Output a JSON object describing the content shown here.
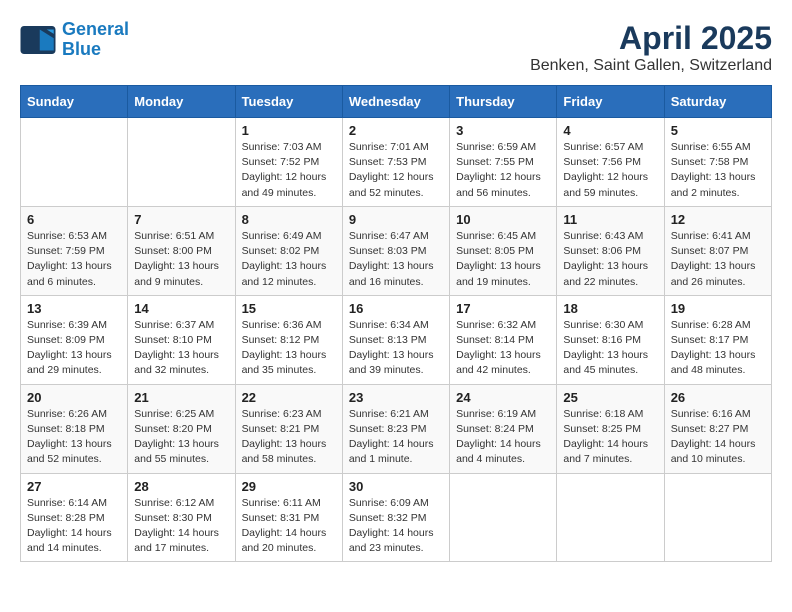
{
  "logo": {
    "line1": "General",
    "line2": "Blue"
  },
  "title": "April 2025",
  "subtitle": "Benken, Saint Gallen, Switzerland",
  "headers": [
    "Sunday",
    "Monday",
    "Tuesday",
    "Wednesday",
    "Thursday",
    "Friday",
    "Saturday"
  ],
  "weeks": [
    [
      {
        "day": "",
        "info": ""
      },
      {
        "day": "",
        "info": ""
      },
      {
        "day": "1",
        "info": "Sunrise: 7:03 AM\nSunset: 7:52 PM\nDaylight: 12 hours and 49 minutes."
      },
      {
        "day": "2",
        "info": "Sunrise: 7:01 AM\nSunset: 7:53 PM\nDaylight: 12 hours and 52 minutes."
      },
      {
        "day": "3",
        "info": "Sunrise: 6:59 AM\nSunset: 7:55 PM\nDaylight: 12 hours and 56 minutes."
      },
      {
        "day": "4",
        "info": "Sunrise: 6:57 AM\nSunset: 7:56 PM\nDaylight: 12 hours and 59 minutes."
      },
      {
        "day": "5",
        "info": "Sunrise: 6:55 AM\nSunset: 7:58 PM\nDaylight: 13 hours and 2 minutes."
      }
    ],
    [
      {
        "day": "6",
        "info": "Sunrise: 6:53 AM\nSunset: 7:59 PM\nDaylight: 13 hours and 6 minutes."
      },
      {
        "day": "7",
        "info": "Sunrise: 6:51 AM\nSunset: 8:00 PM\nDaylight: 13 hours and 9 minutes."
      },
      {
        "day": "8",
        "info": "Sunrise: 6:49 AM\nSunset: 8:02 PM\nDaylight: 13 hours and 12 minutes."
      },
      {
        "day": "9",
        "info": "Sunrise: 6:47 AM\nSunset: 8:03 PM\nDaylight: 13 hours and 16 minutes."
      },
      {
        "day": "10",
        "info": "Sunrise: 6:45 AM\nSunset: 8:05 PM\nDaylight: 13 hours and 19 minutes."
      },
      {
        "day": "11",
        "info": "Sunrise: 6:43 AM\nSunset: 8:06 PM\nDaylight: 13 hours and 22 minutes."
      },
      {
        "day": "12",
        "info": "Sunrise: 6:41 AM\nSunset: 8:07 PM\nDaylight: 13 hours and 26 minutes."
      }
    ],
    [
      {
        "day": "13",
        "info": "Sunrise: 6:39 AM\nSunset: 8:09 PM\nDaylight: 13 hours and 29 minutes."
      },
      {
        "day": "14",
        "info": "Sunrise: 6:37 AM\nSunset: 8:10 PM\nDaylight: 13 hours and 32 minutes."
      },
      {
        "day": "15",
        "info": "Sunrise: 6:36 AM\nSunset: 8:12 PM\nDaylight: 13 hours and 35 minutes."
      },
      {
        "day": "16",
        "info": "Sunrise: 6:34 AM\nSunset: 8:13 PM\nDaylight: 13 hours and 39 minutes."
      },
      {
        "day": "17",
        "info": "Sunrise: 6:32 AM\nSunset: 8:14 PM\nDaylight: 13 hours and 42 minutes."
      },
      {
        "day": "18",
        "info": "Sunrise: 6:30 AM\nSunset: 8:16 PM\nDaylight: 13 hours and 45 minutes."
      },
      {
        "day": "19",
        "info": "Sunrise: 6:28 AM\nSunset: 8:17 PM\nDaylight: 13 hours and 48 minutes."
      }
    ],
    [
      {
        "day": "20",
        "info": "Sunrise: 6:26 AM\nSunset: 8:18 PM\nDaylight: 13 hours and 52 minutes."
      },
      {
        "day": "21",
        "info": "Sunrise: 6:25 AM\nSunset: 8:20 PM\nDaylight: 13 hours and 55 minutes."
      },
      {
        "day": "22",
        "info": "Sunrise: 6:23 AM\nSunset: 8:21 PM\nDaylight: 13 hours and 58 minutes."
      },
      {
        "day": "23",
        "info": "Sunrise: 6:21 AM\nSunset: 8:23 PM\nDaylight: 14 hours and 1 minute."
      },
      {
        "day": "24",
        "info": "Sunrise: 6:19 AM\nSunset: 8:24 PM\nDaylight: 14 hours and 4 minutes."
      },
      {
        "day": "25",
        "info": "Sunrise: 6:18 AM\nSunset: 8:25 PM\nDaylight: 14 hours and 7 minutes."
      },
      {
        "day": "26",
        "info": "Sunrise: 6:16 AM\nSunset: 8:27 PM\nDaylight: 14 hours and 10 minutes."
      }
    ],
    [
      {
        "day": "27",
        "info": "Sunrise: 6:14 AM\nSunset: 8:28 PM\nDaylight: 14 hours and 14 minutes."
      },
      {
        "day": "28",
        "info": "Sunrise: 6:12 AM\nSunset: 8:30 PM\nDaylight: 14 hours and 17 minutes."
      },
      {
        "day": "29",
        "info": "Sunrise: 6:11 AM\nSunset: 8:31 PM\nDaylight: 14 hours and 20 minutes."
      },
      {
        "day": "30",
        "info": "Sunrise: 6:09 AM\nSunset: 8:32 PM\nDaylight: 14 hours and 23 minutes."
      },
      {
        "day": "",
        "info": ""
      },
      {
        "day": "",
        "info": ""
      },
      {
        "day": "",
        "info": ""
      }
    ]
  ]
}
